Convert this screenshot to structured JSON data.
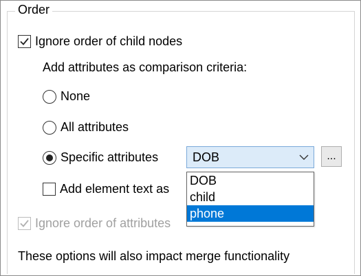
{
  "group": {
    "title": "Order"
  },
  "options": {
    "ignore_child_order": {
      "label": "Ignore order of child nodes",
      "checked": true
    },
    "criteria_label": "Add attributes as comparison criteria:",
    "radios": [
      {
        "label": "None",
        "selected": false
      },
      {
        "label": "All attributes",
        "selected": false
      },
      {
        "label": "Specific attributes",
        "selected": true
      }
    ],
    "add_element_text": {
      "label": "Add element text as",
      "checked": false
    },
    "ignore_attr_order": {
      "label": "Ignore order of attributes",
      "checked": true,
      "disabled": true
    }
  },
  "combo": {
    "value": "DOB",
    "more_button": "...",
    "options": [
      {
        "label": "DOB",
        "selected": false
      },
      {
        "label": "child",
        "selected": false
      },
      {
        "label": "phone",
        "selected": true
      }
    ]
  },
  "note": "These options will also impact merge functionality",
  "colors": {
    "selection": "#0078d7",
    "combo_bg": "#dcebf9",
    "combo_border": "#7aa9d9"
  }
}
